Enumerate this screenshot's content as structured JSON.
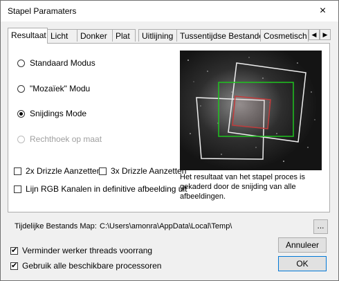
{
  "window": {
    "title": "Stapel Paramaters",
    "close_icon": "×"
  },
  "tabs": [
    {
      "label": "Resultaat",
      "active": true
    },
    {
      "label": "Licht"
    },
    {
      "label": "Donker"
    },
    {
      "label": "Plat"
    },
    {
      "label": "Uitlijning"
    },
    {
      "label": "Tussentijdse Bestanden"
    },
    {
      "label": "Cosmetisch"
    }
  ],
  "tab_scroll": {
    "left": "◀",
    "right": "▶"
  },
  "modes": [
    {
      "label": "Standaard Modus",
      "checked": false,
      "disabled": false
    },
    {
      "label": "\"Mozaïek\" Modu",
      "checked": false,
      "disabled": false
    },
    {
      "label": "Snijdings Mode",
      "checked": true,
      "disabled": false
    },
    {
      "label": "Rechthoek op maat",
      "checked": false,
      "disabled": true
    }
  ],
  "options": {
    "drizzle2x": {
      "label": "2x Drizzle Aanzetten",
      "checked": false
    },
    "drizzle3x": {
      "label": "3x Drizzle Aanzetten",
      "checked": false
    },
    "align_rgb": {
      "label": "Lijn RGB Kanalen in definitive afbeelding uit",
      "checked": false
    }
  },
  "preview": {
    "caption": "Het resultaat van het stapel proces is gekaderd door de snijding van alle afbeeldingen."
  },
  "footer": {
    "temp_label": "Tijdelijke Bestands Map:",
    "temp_path": "C:\\Users\\amonra\\AppData\\Local\\Temp\\",
    "browse_label": "...",
    "reduce_threads": {
      "label": "Verminder werker threads voorrang",
      "checked": true
    },
    "use_all": {
      "label": "Gebruik alle beschikbare processoren",
      "checked": true
    },
    "cancel_label": "Annuleer",
    "ok_label": "OK"
  }
}
